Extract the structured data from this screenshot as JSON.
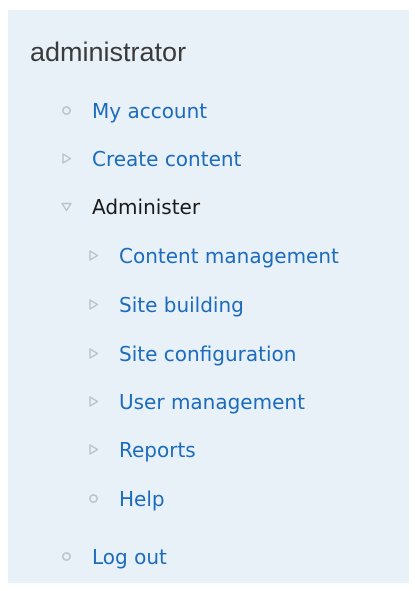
{
  "block": {
    "title": "administrator"
  },
  "menu": {
    "my_account": "My account",
    "create_content": "Create content",
    "administer": "Administer",
    "content_management": "Content management",
    "site_building": "Site building",
    "site_configuration": "Site configuration",
    "user_management": "User management",
    "reports": "Reports",
    "help": "Help",
    "log_out": "Log out"
  },
  "icons": {
    "leaf": "leaf-bullet-icon",
    "collapsed": "triangle-right-icon",
    "expanded": "triangle-down-icon"
  },
  "colors": {
    "block_background": "#e9f1f8",
    "link": "#1c6bbd",
    "active_text": "#1a1a1a",
    "title_text": "#3b3b3b",
    "bullet": "#b8c3cc"
  }
}
